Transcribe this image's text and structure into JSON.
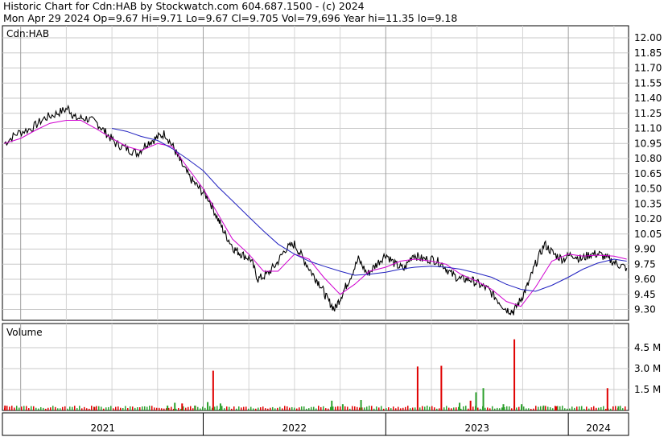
{
  "header": {
    "line1": "Historic Chart for Cdn:HAB by Stockwatch.com 604.687.1500 - (c) 2024",
    "line2": "Mon Apr 29 2024  Op=9.67  Hi=9.71  Lo=9.67  Cl=9.705  Vol=79,696  Year hi=11.35  lo=9.18"
  },
  "chart_data": [
    {
      "type": "line",
      "title": "Cdn:HAB",
      "ylim": [
        9.15,
        12.05
      ],
      "y_ticks": [
        "12.00",
        "11.85",
        "11.70",
        "11.55",
        "11.40",
        "11.25",
        "11.10",
        "10.95",
        "10.80",
        "10.65",
        "10.50",
        "10.35",
        "10.20",
        "10.05",
        "9.90",
        "9.75",
        "9.60",
        "9.45",
        "9.30"
      ],
      "x_labels": [
        "2021",
        "2022",
        "2023",
        "2024"
      ],
      "grid": true,
      "series": [
        {
          "kind": "price",
          "color": "#000000",
          "points": [
            [
              2020.91,
              10.95
            ],
            [
              2020.98,
              11.05
            ],
            [
              2021.06,
              11.1
            ],
            [
              2021.13,
              11.2
            ],
            [
              2021.2,
              11.25
            ],
            [
              2021.26,
              11.3
            ],
            [
              2021.3,
              11.2
            ],
            [
              2021.36,
              11.2
            ],
            [
              2021.42,
              11.15
            ],
            [
              2021.47,
              11.05
            ],
            [
              2021.52,
              10.95
            ],
            [
              2021.58,
              10.9
            ],
            [
              2021.64,
              10.85
            ],
            [
              2021.69,
              10.95
            ],
            [
              2021.74,
              11.0
            ],
            [
              2021.79,
              11.05
            ],
            [
              2021.84,
              10.9
            ],
            [
              2021.88,
              10.75
            ],
            [
              2021.93,
              10.6
            ],
            [
              2021.98,
              10.5
            ],
            [
              2022.03,
              10.4
            ],
            [
              2022.08,
              10.2
            ],
            [
              2022.12,
              10.05
            ],
            [
              2022.17,
              9.9
            ],
            [
              2022.21,
              9.85
            ],
            [
              2022.26,
              9.8
            ],
            [
              2022.3,
              9.6
            ],
            [
              2022.35,
              9.65
            ],
            [
              2022.4,
              9.75
            ],
            [
              2022.45,
              9.9
            ],
            [
              2022.5,
              9.95
            ],
            [
              2022.55,
              9.8
            ],
            [
              2022.6,
              9.65
            ],
            [
              2022.64,
              9.55
            ],
            [
              2022.68,
              9.4
            ],
            [
              2022.72,
              9.3
            ],
            [
              2022.76,
              9.45
            ],
            [
              2022.8,
              9.6
            ],
            [
              2022.85,
              9.8
            ],
            [
              2022.9,
              9.65
            ],
            [
              2022.95,
              9.75
            ],
            [
              2023.0,
              9.85
            ],
            [
              2023.05,
              9.75
            ],
            [
              2023.1,
              9.7
            ],
            [
              2023.15,
              9.85
            ],
            [
              2023.2,
              9.8
            ],
            [
              2023.26,
              9.8
            ],
            [
              2023.31,
              9.75
            ],
            [
              2023.36,
              9.65
            ],
            [
              2023.41,
              9.6
            ],
            [
              2023.46,
              9.6
            ],
            [
              2023.51,
              9.55
            ],
            [
              2023.56,
              9.5
            ],
            [
              2023.61,
              9.4
            ],
            [
              2023.66,
              9.3
            ],
            [
              2023.7,
              9.28
            ],
            [
              2023.74,
              9.4
            ],
            [
              2023.78,
              9.55
            ],
            [
              2023.82,
              9.75
            ],
            [
              2023.87,
              9.95
            ],
            [
              2023.92,
              9.85
            ],
            [
              2023.97,
              9.8
            ],
            [
              2024.02,
              9.85
            ],
            [
              2024.07,
              9.8
            ],
            [
              2024.12,
              9.85
            ],
            [
              2024.17,
              9.85
            ],
            [
              2024.22,
              9.8
            ],
            [
              2024.27,
              9.75
            ],
            [
              2024.32,
              9.71
            ]
          ]
        },
        {
          "kind": "short-average",
          "color": "#d000d0",
          "points": [
            [
              2020.91,
              10.95
            ],
            [
              2021.0,
              11.0
            ],
            [
              2021.08,
              11.08
            ],
            [
              2021.16,
              11.15
            ],
            [
              2021.25,
              11.18
            ],
            [
              2021.33,
              11.18
            ],
            [
              2021.41,
              11.1
            ],
            [
              2021.5,
              11.0
            ],
            [
              2021.58,
              10.92
            ],
            [
              2021.66,
              10.88
            ],
            [
              2021.75,
              10.95
            ],
            [
              2021.83,
              10.92
            ],
            [
              2021.91,
              10.72
            ],
            [
              2022.0,
              10.5
            ],
            [
              2022.08,
              10.25
            ],
            [
              2022.16,
              10.0
            ],
            [
              2022.25,
              9.85
            ],
            [
              2022.33,
              9.68
            ],
            [
              2022.41,
              9.68
            ],
            [
              2022.5,
              9.85
            ],
            [
              2022.58,
              9.8
            ],
            [
              2022.66,
              9.62
            ],
            [
              2022.75,
              9.45
            ],
            [
              2022.83,
              9.55
            ],
            [
              2022.91,
              9.68
            ],
            [
              2023.0,
              9.72
            ],
            [
              2023.08,
              9.78
            ],
            [
              2023.16,
              9.8
            ],
            [
              2023.25,
              9.78
            ],
            [
              2023.33,
              9.75
            ],
            [
              2023.41,
              9.65
            ],
            [
              2023.5,
              9.58
            ],
            [
              2023.58,
              9.5
            ],
            [
              2023.66,
              9.38
            ],
            [
              2023.74,
              9.33
            ],
            [
              2023.82,
              9.52
            ],
            [
              2023.91,
              9.78
            ],
            [
              2024.0,
              9.85
            ],
            [
              2024.08,
              9.83
            ],
            [
              2024.16,
              9.84
            ],
            [
              2024.25,
              9.83
            ],
            [
              2024.32,
              9.8
            ]
          ]
        },
        {
          "kind": "long-average",
          "color": "#2020c0",
          "points": [
            [
              2021.5,
              11.1
            ],
            [
              2021.58,
              11.07
            ],
            [
              2021.66,
              11.02
            ],
            [
              2021.75,
              10.98
            ],
            [
              2021.83,
              10.9
            ],
            [
              2021.91,
              10.8
            ],
            [
              2022.0,
              10.68
            ],
            [
              2022.08,
              10.52
            ],
            [
              2022.16,
              10.38
            ],
            [
              2022.25,
              10.22
            ],
            [
              2022.33,
              10.08
            ],
            [
              2022.41,
              9.95
            ],
            [
              2022.5,
              9.85
            ],
            [
              2022.58,
              9.78
            ],
            [
              2022.66,
              9.73
            ],
            [
              2022.75,
              9.68
            ],
            [
              2022.83,
              9.64
            ],
            [
              2022.91,
              9.65
            ],
            [
              2023.0,
              9.67
            ],
            [
              2023.08,
              9.7
            ],
            [
              2023.16,
              9.72
            ],
            [
              2023.25,
              9.73
            ],
            [
              2023.33,
              9.72
            ],
            [
              2023.41,
              9.7
            ],
            [
              2023.5,
              9.66
            ],
            [
              2023.58,
              9.62
            ],
            [
              2023.66,
              9.55
            ],
            [
              2023.74,
              9.5
            ],
            [
              2023.82,
              9.48
            ],
            [
              2023.91,
              9.54
            ],
            [
              2024.0,
              9.62
            ],
            [
              2024.08,
              9.7
            ],
            [
              2024.16,
              9.76
            ],
            [
              2024.25,
              9.8
            ],
            [
              2024.32,
              9.78
            ]
          ]
        }
      ]
    },
    {
      "type": "bar",
      "title": "Volume",
      "ylim": [
        0,
        5.5
      ],
      "y_ticks": [
        "4.5 M",
        "3.0 M",
        "1.5 M"
      ],
      "up_color": "#2ca02c",
      "down_color": "#e00000",
      "bars": [
        [
          2020.91,
          0.35,
          "down"
        ],
        [
          2021.4,
          0.25,
          "down"
        ],
        [
          2021.8,
          0.35,
          "up"
        ],
        [
          2021.84,
          0.55,
          "up"
        ],
        [
          2021.88,
          0.5,
          "down"
        ],
        [
          2021.95,
          0.35,
          "up"
        ],
        [
          2022.02,
          0.6,
          "up"
        ],
        [
          2022.05,
          2.85,
          "down"
        ],
        [
          2022.09,
          0.5,
          "up"
        ],
        [
          2022.7,
          0.7,
          "up"
        ],
        [
          2022.76,
          0.45,
          "up"
        ],
        [
          2022.86,
          0.75,
          "up"
        ],
        [
          2023.17,
          3.15,
          "down"
        ],
        [
          2023.3,
          3.2,
          "down"
        ],
        [
          2023.4,
          0.55,
          "up"
        ],
        [
          2023.46,
          0.7,
          "down"
        ],
        [
          2023.49,
          1.3,
          "up"
        ],
        [
          2023.53,
          1.6,
          "up"
        ],
        [
          2023.64,
          0.45,
          "up"
        ],
        [
          2023.7,
          5.1,
          "down"
        ],
        [
          2023.74,
          0.45,
          "up"
        ],
        [
          2023.86,
          0.35,
          "up"
        ],
        [
          2023.93,
          0.3,
          "down"
        ],
        [
          2024.21,
          1.6,
          "down"
        ],
        [
          2024.27,
          0.3,
          "up"
        ]
      ]
    }
  ]
}
